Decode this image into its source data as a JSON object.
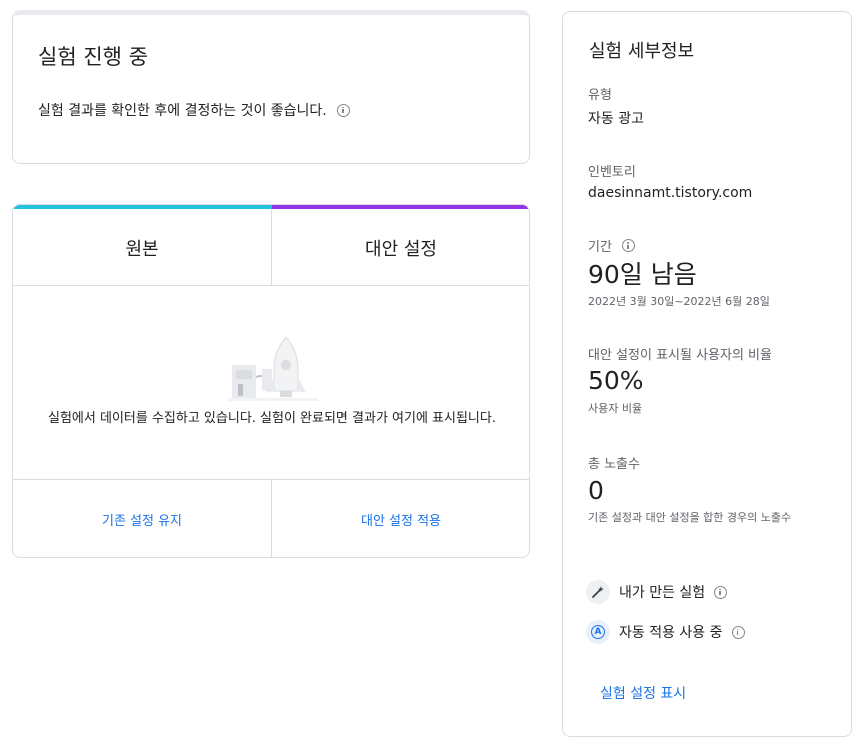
{
  "status": {
    "title": "실험 진행 중",
    "description": "실험 결과를 확인한 후에 결정하는 것이 좋습니다.",
    "info_icon": "info-icon"
  },
  "comparison": {
    "tabs": [
      {
        "label": "원본",
        "accent": "#24c1e0"
      },
      {
        "label": "대안 설정",
        "accent": "#9334e6"
      }
    ],
    "empty_message": "실험에서 데이터를 수집하고 있습니다. 실험이 완료되면 결과가 여기에 표시됩니다.",
    "illustration": "rocket-launch-illustration",
    "keep_label": "기존 설정 유지",
    "apply_label": "대안 설정 적용"
  },
  "details": {
    "title": "실험 세부정보",
    "type": {
      "label": "유형",
      "value": "자동 광고"
    },
    "inventory": {
      "label": "인벤토리",
      "value": "daesinnamt.tistory.com"
    },
    "period": {
      "label": "기간",
      "value": "90일 남음",
      "range": "2022년 3월 30일~2022년 6월 28일"
    },
    "ratio": {
      "label": "대안 설정이 표시될 사용자의 비율",
      "value": "50%",
      "sub": "사용자 비율"
    },
    "impressions": {
      "label": "총 노출수",
      "value": "0",
      "sub": "기존 설정과 대안 설정을 합한 경우의 노출수"
    },
    "created_by": {
      "label": "내가 만든 실험",
      "icon": "magic-wand-icon"
    },
    "auto_apply": {
      "label": "자동 적용 사용 중",
      "icon": "auto-apply-icon"
    },
    "show_settings": "실험 설정 표시"
  },
  "colors": {
    "link": "#1a73e8",
    "original": "#24c1e0",
    "alternative": "#9334e6"
  }
}
